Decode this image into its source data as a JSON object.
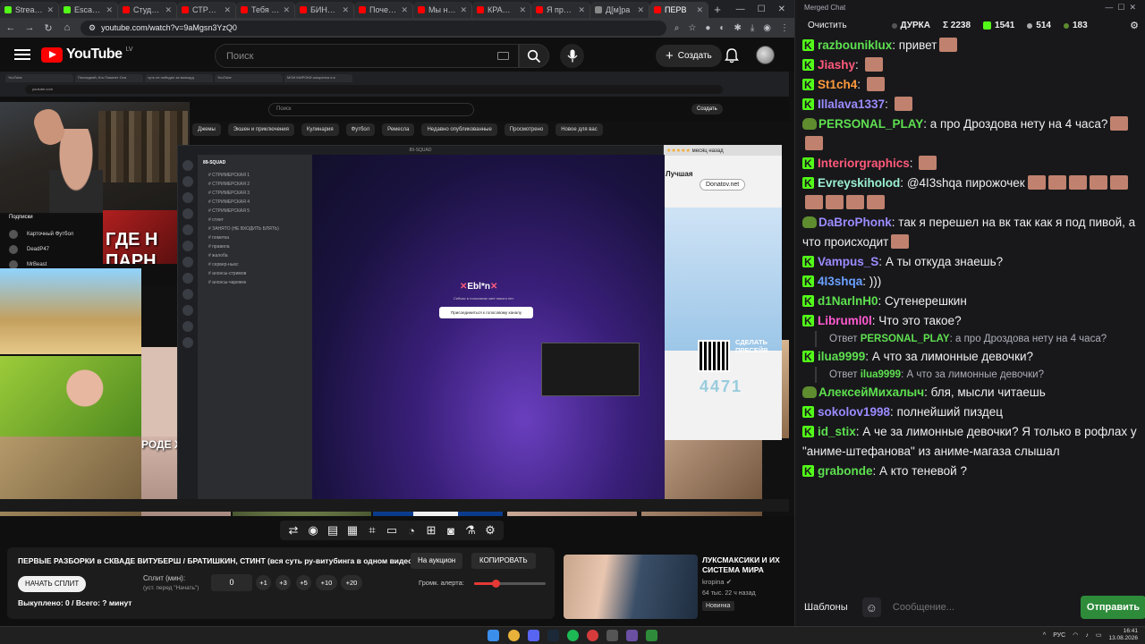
{
  "browser": {
    "tabs": [
      {
        "label": "Stream - Ki",
        "color": "#53fc18"
      },
      {
        "label": "Escape Fr",
        "color": "#53fc18"
      },
      {
        "label": "Студия ...",
        "color": "#ff0000"
      },
      {
        "label": "СТРИМЕ...",
        "color": "#ff0000"
      },
      {
        "label": "Тебя Вму",
        "color": "#ff0000"
      },
      {
        "label": "БИНАРН...",
        "color": "#ff0000"
      },
      {
        "label": "Почему В",
        "color": "#ff0000"
      },
      {
        "label": "Мы наш",
        "color": "#ff0000"
      },
      {
        "label": "КРАСОТА",
        "color": "#ff0000"
      },
      {
        "label": "Я прозна",
        "color": "#ff0000"
      },
      {
        "label": "Д[м]ра",
        "color": "#888888"
      },
      {
        "label": "ПЕРВ",
        "color": "#ff0000"
      }
    ],
    "url": "youtube.com/watch?v=9aMgsn3YzQ0"
  },
  "youtube": {
    "logo_text": "YouTube",
    "country_code": "LV",
    "search_placeholder": "Поиск",
    "create_label": "Создать"
  },
  "video": {
    "inner_tabs": [
      "YouTube",
      "Последний, Кто Покинет Оса",
      "чуть не победил за волкорд",
      "YouTube",
      "МОИ МИРОКИ загорелся я в"
    ],
    "inner_url": "youtube.com",
    "inner_search": "Поиск",
    "inner_create": "Создать",
    "chips": [
      "Джемы",
      "Экшен и приключения",
      "Кулинария",
      "Футбол",
      "Ремесла",
      "Недавно опубликованные",
      "Просмотрено",
      "Новое для вас"
    ],
    "sidebar_title": "Подписки",
    "sidebar_items": [
      "Карточный Футбол",
      "DeadP47",
      "MrBeast"
    ],
    "discord": {
      "window_title": "89-SQUAD",
      "server_name": "89-SQUAD",
      "channels": [
        "СТРИМЕРСКАЯ 1",
        "СТРИМЕРСКАЯ 2",
        "СТРИМЕРСКАЯ 3",
        "СТРИМЕРСКАЯ 4",
        "СТРИМЕРСКАЯ 5",
        "стинт",
        "ЗАНЯТО (НЕ ВХОДИТЬ БЛЯТЬ)",
        "пометка",
        "правила",
        "жалоба",
        "сервер-ньюс",
        "анонсы-стримов",
        "анонсы-чарежек"
      ],
      "voice_title": "Ebl*n",
      "voice_sub": "Сейчас в голосовом чате никого нет",
      "join_label": "Присоединиться к голосовому каналу"
    },
    "overlay_head": "ГДЕ Н",
    "overlay_head2": "ПАРН",
    "overlay_thin": "РОДЕ ХУДЕЕШЬ",
    "donatov": "Donatov.net",
    "month_ago": "месяц назад",
    "best_label": "Лучшая",
    "promo_text": "СДЕЛАТЬ ПРЕСЕЙВ",
    "counter": "4471",
    "stars": "★★★★★"
  },
  "player": {
    "controls": [
      "loop-icon",
      "broadcast-icon",
      "layers-icon",
      "clapper-icon",
      "crop-icon",
      "frame-icon",
      "speed-icon",
      "add-box-icon",
      "camera-icon",
      "flask-icon",
      "gear-icon"
    ]
  },
  "panel": {
    "title": "ПЕРВЫЕ РАЗБОРКИ в СКВАДЕ ВИТУБЕРШ / БРАТИШКИН, СТИНТ (вся суть ру-витубинга в одном видео)",
    "auction_label": "На аукцион",
    "copy_label": "КОПИРОВАТЬ",
    "start_label": "НАЧАТЬ СПЛИТ",
    "split_label": "Сплит (мин):",
    "split_hint": "(уст. перед \"Начать\")",
    "split_value": "0",
    "increments": [
      "+1",
      "+3",
      "+5",
      "+10",
      "+20"
    ],
    "volume_label": "Громк. алерта:",
    "volume_level": 0.3,
    "stats": "Выкуплено: 0 / Всего: ? минут"
  },
  "recommended": {
    "title": "ЛУКСМАКСИКИ И ИХ СИСТЕМА МИРА",
    "channel": "kropina",
    "meta": "64 тыс.   22 ч назад",
    "badge": "Новинка"
  },
  "chat": {
    "window_title": "Merged Chat",
    "clear_label": "Очистить",
    "channel_name": "ДУРКА",
    "total": "Σ 2238",
    "kick_count": "1541",
    "viewers2": "514",
    "viewers3": "183",
    "messages": [
      {
        "badge": "kick",
        "name": "razbouniklux",
        "color": "#5ee04f",
        "text": "привет",
        "emotes": 1
      },
      {
        "badge": "kick",
        "name": "Jiashy",
        "color": "#ff5a7a",
        "text": "",
        "emotes": 1
      },
      {
        "badge": "kick",
        "name": "St1ch4",
        "color": "#ff9a3c",
        "text": "",
        "emotes": 1
      },
      {
        "badge": "kick",
        "name": "Illalava1337",
        "color": "#9a8cff",
        "text": "",
        "emotes": 1
      },
      {
        "badge": "frog",
        "name": "PERSONAL_PLAY",
        "color": "#5ee04f",
        "text": "а про Дроздова нету на 4 часа?",
        "emotes": 2
      },
      {
        "badge": "kick",
        "name": "Interiorgraphics",
        "color": "#ff5a7a",
        "text": "",
        "emotes": 1
      },
      {
        "badge": "kick",
        "name": "Evreyskiholod",
        "color": "#9af0d0",
        "text": "@4I3shqa пирожочек",
        "emotes": 9
      },
      {
        "badge": "frog",
        "name": "DaBroPhonk",
        "color": "#9a8cff",
        "text": "так я перешел на вк так как я под пивой, а что происходит",
        "emotes": 1
      },
      {
        "badge": "kick",
        "name": "Vampus_S",
        "color": "#9a8cff",
        "text": "А ты откуда знаешь?",
        "emotes": 0
      },
      {
        "badge": "kick",
        "name": "4I3shqa",
        "color": "#6aa0ff",
        "text": ")))",
        "emotes": 0
      },
      {
        "badge": "kick",
        "name": "d1NarlnH0",
        "color": "#5ee04f",
        "text": "Сутенерешкин",
        "emotes": 0
      },
      {
        "badge": "kick",
        "name": "Libruml0l",
        "color": "#ff5ad0",
        "text": "Что это такое?",
        "emotes": 0
      },
      {
        "badge": "kick",
        "name": "ilua9999",
        "color": "#5ee04f",
        "text": "А что за лимонные девочки?",
        "emotes": 0,
        "reply_to": "PERSONAL_PLAY",
        "reply_text": "а про Дроздова нету на 4 часа?"
      },
      {
        "badge": "frog",
        "name": "АлексейМихалыч",
        "color": "#5ee04f",
        "text": "бля, мысли читаешь",
        "emotes": 0,
        "reply_to": "ilua9999",
        "reply_text": "А что за лимонные девочки?"
      },
      {
        "badge": "kick",
        "name": "sokolov1998",
        "color": "#9a8cff",
        "text": "полнейший пиздец",
        "emotes": 0
      },
      {
        "badge": "kick",
        "name": "id_stix",
        "color": "#5ee04f",
        "text": "А че за лимонные девочки? Я только в рофлах у \"аниме-штефанова\" из аниме-магаза слышал",
        "emotes": 0
      },
      {
        "badge": "kick",
        "name": "grabonde",
        "color": "#5ee04f",
        "text": "А кто теневой ?",
        "emotes": 0
      }
    ],
    "reply_prefix": "Ответ",
    "templates_label": "Шаблоны",
    "input_placeholder": "Сообщение...",
    "send_label": "Отправить"
  },
  "taskbar": {
    "lang": "РУС",
    "time": "16:41",
    "date": "13.08.2026"
  }
}
